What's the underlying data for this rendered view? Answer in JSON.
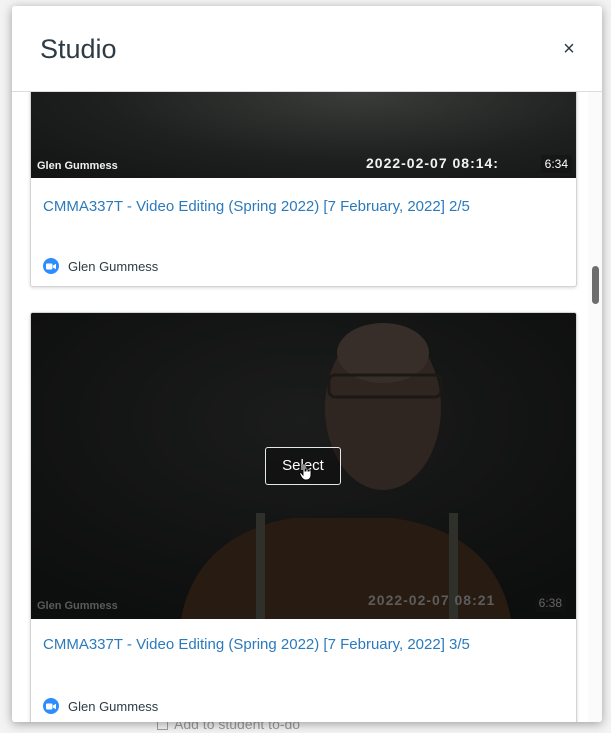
{
  "modal": {
    "title": "Studio",
    "close_label": "×"
  },
  "videos": [
    {
      "title": "CMMA337T - Video Editing (Spring 2022) [7 February, 2022] 2/5",
      "author": "Glen Gummess",
      "overlay_name": "Glen Gummess",
      "overlay_date": "2022-02-07 08:14:",
      "duration": "6:34"
    },
    {
      "title": "CMMA337T - Video Editing (Spring 2022) [7 February, 2022] 3/5",
      "author": "Glen Gummess",
      "overlay_name": "Glen Gummess",
      "overlay_date": "2022-02-07 08:21",
      "duration": "6:38",
      "select_label": "Select"
    }
  ],
  "background": {
    "todo_label": "Add to student to-do"
  },
  "colors": {
    "link": "#2b7abc",
    "zoom_blue": "#2d8cff",
    "text": "#2d3b45"
  }
}
